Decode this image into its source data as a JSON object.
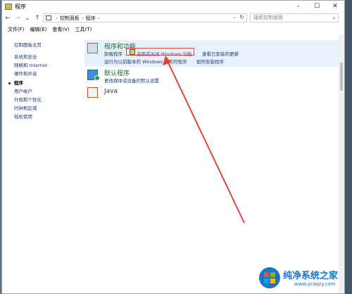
{
  "window": {
    "title": "程序",
    "controls": {
      "minimize": "–",
      "maximize": "☐",
      "close": "✕"
    }
  },
  "toolbar": {
    "back": "←",
    "forward": "→",
    "recent": "⌄",
    "up": "↑",
    "breadcrumb": [
      "控制面板",
      "程序"
    ],
    "breadcrumb_sep": "›",
    "dropdown": "⌄",
    "refresh": "↻",
    "search_placeholder": "搜索控制面板",
    "search_icon": "⌕"
  },
  "menubar": {
    "items": [
      "文件(F)",
      "编辑(E)",
      "查看(V)",
      "工具(T)"
    ]
  },
  "sidebar": {
    "items": [
      {
        "label": "控制面板主页"
      },
      {
        "label": "系统和安全"
      },
      {
        "label": "网络和 Internet"
      },
      {
        "label": "硬件和声音"
      },
      {
        "label": "程序",
        "active": true
      },
      {
        "label": "用户帐户"
      },
      {
        "label": "外观和个性化"
      },
      {
        "label": "时钟和区域"
      },
      {
        "label": "轻松使用"
      }
    ]
  },
  "sections": {
    "programs_features": {
      "title": "程序和功能",
      "links": [
        "卸载程序",
        "启用或关闭 Windows 功能",
        "查看已安装的更新",
        "运行为以前版本的 Windows 编写的程序",
        "如何安装程序"
      ]
    },
    "default_programs": {
      "title": "默认程序",
      "links": [
        "更改媒体或设备的默认设置"
      ]
    },
    "java": {
      "title": "Java"
    }
  },
  "watermark": {
    "title": "纯净系统之家",
    "url": "www.ycwjzy.com"
  },
  "colors": {
    "accent_green": "#1a6a24",
    "link_blue": "#1f3a68",
    "highlight_red": "#e0443a",
    "brand_blue": "#1b74c9"
  }
}
